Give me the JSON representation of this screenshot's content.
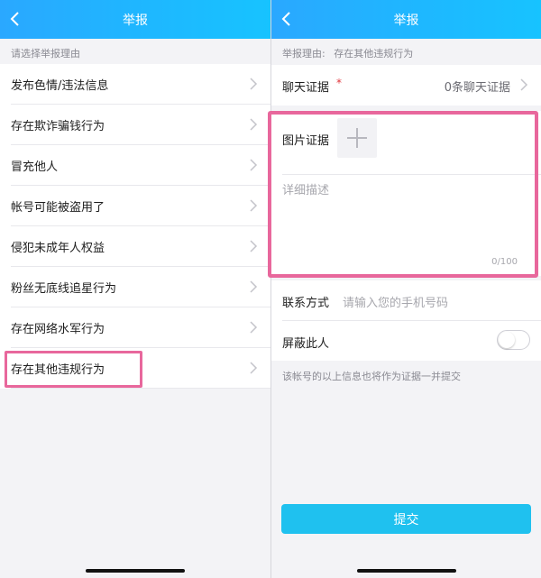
{
  "left_screen": {
    "nav_title": "举报",
    "hint": "请选择举报理由",
    "reasons": [
      "发布色情/违法信息",
      "存在欺诈骗钱行为",
      "冒充他人",
      "帐号可能被盗用了",
      "侵犯未成年人权益",
      "粉丝无底线追星行为",
      "存在网络水军行为",
      "存在其他违规行为"
    ],
    "highlight_color": "#e8679c"
  },
  "right_screen": {
    "nav_title": "举报",
    "reason_label": "举报理由:",
    "reason_value": "存在其他违规行为",
    "chat_evidence_label": "聊天证据",
    "required_mark": "*",
    "chat_evidence_value": "0条聊天证据",
    "image_evidence_label": "图片证据",
    "description_placeholder": "详细描述",
    "char_count": "0/100",
    "contact_label": "联系方式",
    "contact_placeholder": "请输入您的手机号码",
    "block_label": "屏蔽此人",
    "block_on": false,
    "footnote": "该帐号的以上信息也将作为证据一并提交",
    "submit_label": "提交"
  },
  "colors": {
    "nav_gradient_start": "#2aa8ff",
    "nav_gradient_end": "#17c3ff",
    "submit_bg": "#1fc1ef",
    "required": "#e0343b",
    "highlight": "#e8679c"
  },
  "icons": [
    "back-arrow-icon",
    "chevron-right-icon",
    "plus-icon"
  ]
}
